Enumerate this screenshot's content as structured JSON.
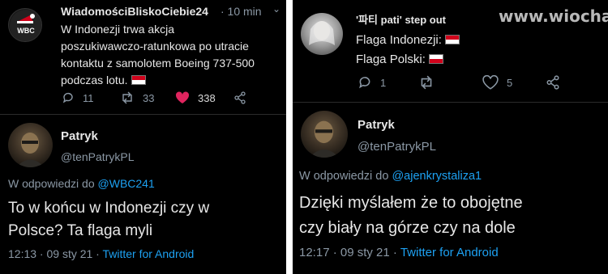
{
  "colors": {
    "flag_red": "#d0021b",
    "link": "#1da1f2",
    "like": "#e0245e"
  },
  "left": {
    "quoted": {
      "name": "WiadomościBliskoCiebie24",
      "time": "· 10 min",
      "avatar_text": "WBC",
      "lines": [
        "W Indonezji trwa akcja",
        "poszukiwawczo-ratunkowa po utracie",
        "kontaktu z samolotem Boeing 737-500",
        "podczas lotu."
      ],
      "replies": "11",
      "retweets": "33",
      "likes": "338"
    },
    "reply": {
      "name": "Patryk",
      "handle": "@tenPatrykPL",
      "reply_prefix": "W odpowiedzi do",
      "reply_to": "@WBC241",
      "text_lines": [
        "To w końcu w Indonezji czy w",
        "Polsce? Ta flaga myli"
      ],
      "time": "12:13 · 09 sty 21 ·",
      "source": "Twitter for Android"
    }
  },
  "right": {
    "quoted": {
      "name": "'파티 pati' step out",
      "watermark": "www.wiocha.pl",
      "lines": [
        "Flaga Indonezji:",
        "Flaga Polski:"
      ],
      "replies": "1",
      "likes": "5"
    },
    "reply": {
      "name": "Patryk",
      "handle": "@tenPatrykPL",
      "reply_prefix": "W odpowiedzi do",
      "reply_to": "@ajenkrystaliza1",
      "text_lines": [
        "Dzięki myślałem że to obojętne",
        "czy biały na górze czy na dole"
      ],
      "time": "12:17 · 09 sty 21 ·",
      "source": "Twitter for Android"
    }
  }
}
